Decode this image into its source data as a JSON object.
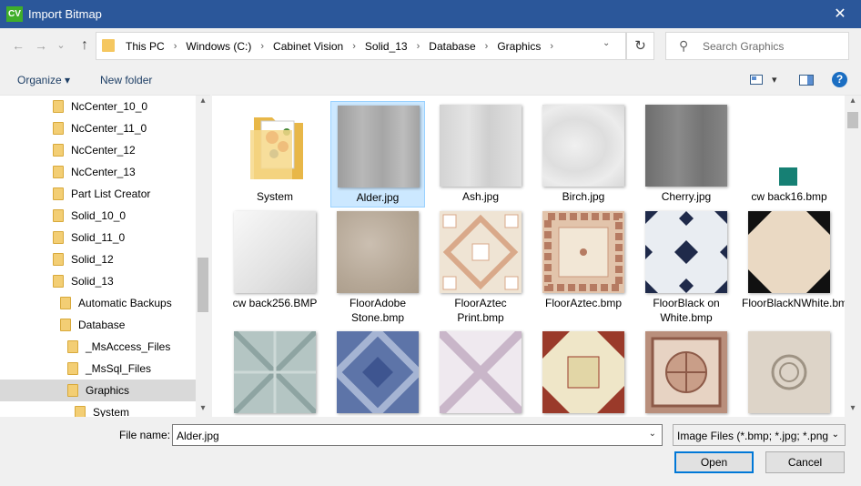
{
  "window": {
    "app_icon": "CV",
    "title": "Import Bitmap",
    "close_glyph": "✕"
  },
  "nav": {
    "back_glyph": "←",
    "forward_glyph": "→",
    "recent_glyph": "⌄",
    "up_glyph": "↑"
  },
  "address": {
    "crumbs": [
      "This PC",
      "Windows (C:)",
      "Cabinet Vision",
      "Solid_13",
      "Database",
      "Graphics"
    ],
    "separator": "›",
    "dropdown_glyph": "⌄",
    "refresh_glyph": "↻"
  },
  "search": {
    "placeholder": "Search Graphics",
    "icon": "⚲"
  },
  "toolbar": {
    "organize": "Organize ▾",
    "new_folder": "New folder",
    "view_dropdown": "▾",
    "help": "?"
  },
  "tree": {
    "items": [
      {
        "label": "NcCenter_10_0"
      },
      {
        "label": "NcCenter_11_0"
      },
      {
        "label": "NcCenter_12"
      },
      {
        "label": "NcCenter_13"
      },
      {
        "label": "Part List Creator"
      },
      {
        "label": "Solid_10_0"
      },
      {
        "label": "Solid_11_0"
      },
      {
        "label": "Solid_12"
      },
      {
        "label": "Solid_13"
      },
      {
        "label": "Automatic Backups"
      },
      {
        "label": "Database"
      },
      {
        "label": "_MsAccess_Files"
      },
      {
        "label": "_MsSql_Files"
      },
      {
        "label": "Graphics",
        "selected": true
      },
      {
        "label": "System"
      }
    ],
    "scroll_up": "▴",
    "scroll_down": "▾"
  },
  "files": {
    "items": [
      {
        "label": "System",
        "icon": "folder-icon"
      },
      {
        "label": "Alder.jpg",
        "selected": true
      },
      {
        "label": "Ash.jpg"
      },
      {
        "label": "Birch.jpg"
      },
      {
        "label": "Cherry.jpg"
      },
      {
        "label": "cw back16.bmp"
      },
      {
        "label": "cw back256.BMP"
      },
      {
        "label": "FloorAdobe Stone.bmp"
      },
      {
        "label": "FloorAztec Print.bmp"
      },
      {
        "label": "FloorAztec.bmp"
      },
      {
        "label": "FloorBlack on White.bmp"
      },
      {
        "label": "FloorBlackNWhite.bmp"
      },
      {
        "label": ""
      },
      {
        "label": ""
      },
      {
        "label": ""
      },
      {
        "label": ""
      },
      {
        "label": ""
      },
      {
        "label": ""
      }
    ],
    "scroll_up": "▴",
    "scroll_down": "▾"
  },
  "footer": {
    "file_name_label": "File name:",
    "file_name_value": "Alder.jpg",
    "filter_value": "Image Files (*.bmp; *.jpg; *.png",
    "dropdown_glyph": "⌄",
    "open_label": "Open",
    "cancel_label": "Cancel"
  },
  "colors": {
    "title_bar": "#2b579a",
    "selection": "#cce8ff",
    "tree_selection": "#d9d9d9",
    "accent": "#0078d7"
  }
}
